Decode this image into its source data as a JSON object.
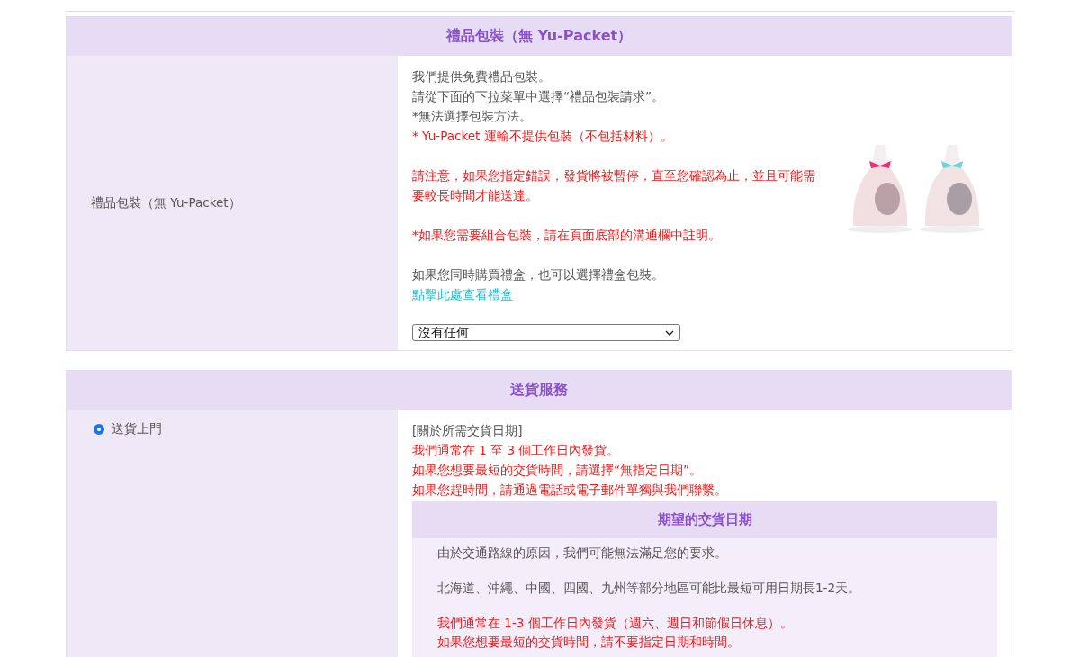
{
  "sections": [
    {
      "title": "禮品包裝（無 Yu-Packet）",
      "option": {
        "kind": "label",
        "label": "禮品包裝（無 Yu-Packet）"
      },
      "paragraphs": [
        {
          "kind": "note",
          "lines": [
            "我們提供免費禮品包裝。",
            "請從下面的下拉菜單中選擇“禮品包裝請求”。",
            "*無法選擇包裝方法。"
          ]
        },
        {
          "kind": "warning",
          "lines": [
            "* Yu-Packet 運輸不提供包裝（不包括材料）。"
          ]
        },
        {
          "kind": "warning",
          "gap": true,
          "lines": [
            "請注意，如果您指定錯誤，發貨將被暫停，直至您確認為止，並且可能需要較長時間才能送達。"
          ]
        },
        {
          "kind": "warning",
          "gap": true,
          "lines": [
            "*如果您需要組合包裝，請在頁面底部的溝通欄中註明。"
          ]
        },
        {
          "kind": "note",
          "gap": true,
          "lines": [
            "如果您同時購買禮盒，也可以選擇禮盒包裝。"
          ]
        },
        {
          "kind": "link",
          "lines": [
            "點擊此處查看禮盒"
          ]
        }
      ],
      "select": {
        "value": "沒有任何"
      }
    },
    {
      "title": "送貨服務",
      "option": {
        "kind": "radio",
        "label": "送貨上門",
        "selected": true
      },
      "paragraphs": [
        {
          "kind": "note",
          "lines": [
            "[關於所需交貨日期]"
          ]
        },
        {
          "kind": "warning",
          "lines": [
            "我們通常在 1 至 3 個工作日內發貨。",
            "如果您想要最短的交貨時間，請選擇“無指定日期”。",
            "如果您趕時間，請通過電話或電子郵件單獨與我們聯繫。"
          ]
        }
      ],
      "subpanel": {
        "title": "期望的交貨日期",
        "paragraphs": [
          {
            "kind": "note",
            "lines": [
              "由於交通路線的原因，我們可能無法滿足您的要求。"
            ]
          },
          {
            "kind": "note",
            "gap": true,
            "lines": [
              "北海道、沖繩、中國、四國、九州等部分地區可能比最短可用日期長1-2天。"
            ]
          },
          {
            "kind": "warning",
            "gap": true,
            "lines": [
              "我們通常在 1-3 個工作日內發貨（週六、週日和節假日休息）。",
              "如果您想要最短的交貨時間，請不要指定日期和時間。"
            ]
          }
        ]
      }
    }
  ]
}
